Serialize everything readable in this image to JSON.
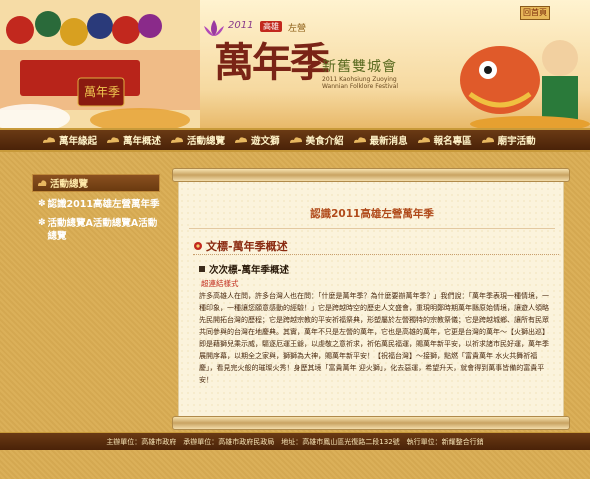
{
  "header": {
    "home_button": "回首頁",
    "logo_year": "2011",
    "logo_badge": "高雄",
    "logo_left": "左營",
    "logo_main": "萬年季",
    "logo_sub": "新舊雙城會",
    "logo_sub2": "2011 Kaohsiung Zuoying Wannian Folklore Festival",
    "banner_text": "萬年季"
  },
  "nav": {
    "items": [
      "萬年緣起",
      "萬年概述",
      "活動總覽",
      "遊文獅",
      "美食介紹",
      "最新消息",
      "報名專區",
      "廟宇活動"
    ]
  },
  "sidebar": {
    "title": "活動總覽",
    "links": [
      "認識2011高雄左營萬年季",
      "活動總覽A活動總覽A活動總覽"
    ]
  },
  "content": {
    "page_title": "認識2011高雄左營萬年季",
    "heading": "文標-萬年季概述",
    "subheading": "次次標-萬年季概述",
    "link_style": "超連結樣式",
    "body": "許多高雄人在問，許多台灣人也在問：「什麼是萬年季？為什麼要辦萬年季？」我們說：「萬年季表現一種情境，一種印象，一種讓您願意感動的經驗！」它是跨越時空的歷史人文盛會，重現明鄭時期萬年縣原始情境，讓遊人領略先民開拓台灣的歷程；它是跨越宗教的平安祈福祭典，形塑屬於左營獨特的宗教祭儀；它是跨越城鄉、讓所有民眾共同參與的台灣在地慶典。其實，萬年不只是左營的萬年，它也是高雄的萬年，它更是台灣的萬年～【火獅出巡】即是藉獅兒乘示威，驅逐厄運王爺，以虔敬之意祈求，祈佑萬民福運，賜萬年新平安，以祈求諸市民好運，萬年季展開序幕，以期全之家與，獅獅為大神，賜萬年新平安！【祝福台灣】～接獅，點燃「富貴萬年 水火共舞祈福慶」，看見完火般的璀璨火秀！身歷其境「富貴萬年 迎火獅」，化去惡運，希望升天，就會得到萬事皆備的富貴平安！"
  },
  "footer": {
    "text": "主辦單位：高雄市政府　承辦單位：高雄市政府民政局　地址：高雄市鳳山區光復路二段132號　執行單位：新耀整合行銷"
  },
  "colors": {
    "background": "#d9ad55",
    "nav_bg": "#4a2208",
    "accent_red": "#b04a1a",
    "paper": "#fbf3dc"
  }
}
